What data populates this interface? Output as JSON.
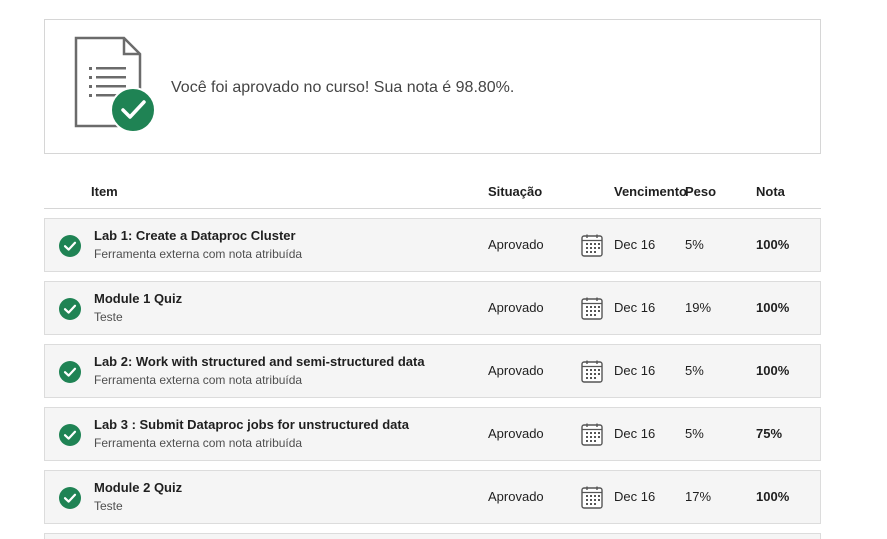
{
  "banner": {
    "message": "Você foi aprovado no curso! Sua nota é 98.80%.",
    "icon": "document-check-icon"
  },
  "table": {
    "headers": {
      "item": "Item",
      "status": "Situação",
      "due": "Vencimento",
      "weight": "Peso",
      "grade": "Nota"
    },
    "rows": [
      {
        "title": "Lab 1: Create a Dataproc Cluster",
        "type": "Ferramenta externa com nota atribuída",
        "status": "Aprovado",
        "due": "Dec 16",
        "weight": "5%",
        "grade": "100%"
      },
      {
        "title": "Module 1 Quiz",
        "type": "Teste",
        "status": "Aprovado",
        "due": "Dec 16",
        "weight": "19%",
        "grade": "100%"
      },
      {
        "title": "Lab 2: Work with structured and semi-structured data",
        "type": "Ferramenta externa com nota atribuída",
        "status": "Aprovado",
        "due": "Dec 16",
        "weight": "5%",
        "grade": "100%"
      },
      {
        "title": "Lab 3 : Submit Dataproc jobs for unstructured data",
        "type": "Ferramenta externa com nota atribuída",
        "status": "Aprovado",
        "due": "Dec 16",
        "weight": "5%",
        "grade": "75%"
      },
      {
        "title": "Module 2 Quiz",
        "type": "Teste",
        "status": "Aprovado",
        "due": "Dec 16",
        "weight": "17%",
        "grade": "100%"
      }
    ]
  },
  "colors": {
    "success_green": "#1f8354",
    "row_background": "#f5f5f5",
    "border": "#d6d6d6"
  }
}
